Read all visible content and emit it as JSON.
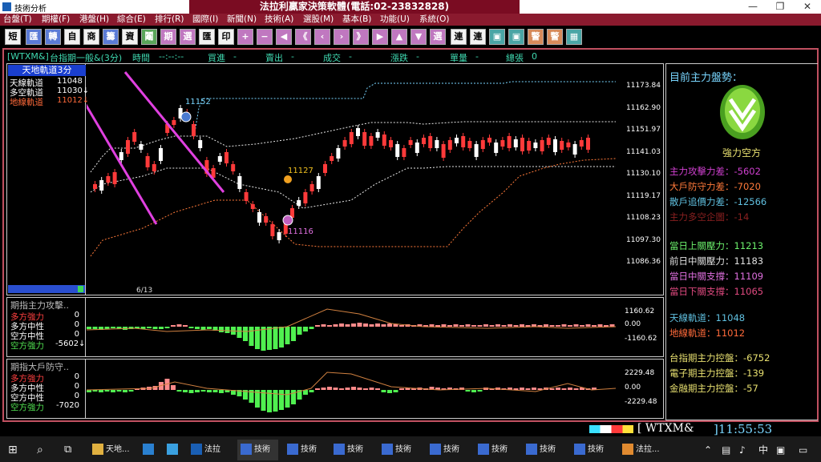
{
  "window": {
    "app_title": "技術分析",
    "banner": "法拉利贏家決策軟體(電話:02-23832828)",
    "min": "—",
    "max": "❐",
    "close": "✕"
  },
  "menu": [
    "台盤(T)",
    "期權(F)",
    "港盤(H)",
    "綜合(E)",
    "排行(R)",
    "國際(I)",
    "新聞(N)",
    "技術(A)",
    "選股(M)",
    "基本(B)",
    "功能(U)",
    "系統(O)"
  ],
  "toolbar": [
    "短",
    "匯",
    "轉",
    "自",
    "商",
    "籌",
    "資",
    "鬮",
    "期",
    "選",
    "匯",
    "印",
    "+",
    "−",
    "◀",
    "《",
    "‹",
    "›",
    "》",
    "▶",
    "▲",
    "▼",
    "選",
    "連",
    "連",
    "▣",
    "▣",
    "警",
    "警",
    "▦"
  ],
  "info": {
    "symbol": "[WTXM&]",
    "name": "台指期一般&(3分)",
    "time_label": "時間",
    "time_val": "--:--:--",
    "buy_label": "買進",
    "buy_val": "-",
    "sell_label": "賣出",
    "sell_val": "-",
    "deal_label": "成交",
    "deal_val": "-",
    "chg_label": "漲跌",
    "chg_val": "-",
    "vol_label": "單量",
    "vol_val": "-",
    "total_label": "總張",
    "total_val": "0"
  },
  "indicator": {
    "title": "天地軌道3分",
    "items": [
      {
        "label": "天線軌道",
        "value": "11048",
        "color": "#ffffff"
      },
      {
        "label": "多空軌道",
        "value": "11030↓",
        "color": "#ffffff"
      },
      {
        "label": "地線軌道",
        "value": "11012↓",
        "color": "#ff6a3a"
      }
    ]
  },
  "price_scale": [
    "11173.84",
    "11162.90",
    "11151.97",
    "11141.03",
    "11130.10",
    "11119.17",
    "11108.23",
    "11097.30",
    "11086.36"
  ],
  "annotations": {
    "high": "11152",
    "mid": "11127",
    "low": "11116",
    "date": "6/13"
  },
  "side": {
    "title": "目前主力盤勢：",
    "status": "強力空方",
    "items": [
      {
        "label": "主力攻擊力差：",
        "value": "-5602",
        "color": "#d040d0"
      },
      {
        "label": "大戶防守力差：",
        "value": "-7020",
        "color": "#ff7a3a"
      },
      {
        "label": "散戶追價力差：",
        "value": "-12566",
        "color": "#60c0e0"
      },
      {
        "label": "主力多空企圖：",
        "value": "-14",
        "color": "#8a2020"
      },
      {
        "label": "當日上關壓力：",
        "value": "11213",
        "color": "#6cf06c"
      },
      {
        "label": "前日中關壓力：",
        "value": "11183",
        "color": "#e0e0e0"
      },
      {
        "label": "當日中關支撐：",
        "value": "11109",
        "color": "#e070e0"
      },
      {
        "label": "當日下關支撐：",
        "value": "11065",
        "color": "#e04a80"
      },
      {
        "label": "天線軌道：",
        "value": "11048",
        "color": "#60c0e0"
      },
      {
        "label": "地線軌道：",
        "value": "11012",
        "color": "#ff6a3a"
      },
      {
        "label": "台指期主力控盤：",
        "value": "-6752",
        "color": "#e8e070"
      },
      {
        "label": "電子期主力控盤：",
        "value": "-139",
        "color": "#e8e070"
      },
      {
        "label": "金融期主力控盤：",
        "value": "-57",
        "color": "#e8e070"
      }
    ]
  },
  "sub1": {
    "title": "期指主力攻擊..",
    "scale": [
      "1160.62",
      "0.00",
      "-1160.62"
    ],
    "items": [
      {
        "label": "多方強力",
        "value": "0",
        "color": "#ff4040"
      },
      {
        "label": "多方中性",
        "value": "0",
        "color": "#ffffff"
      },
      {
        "label": "空方中性",
        "value": "0",
        "color": "#ffffff"
      },
      {
        "label": "空方強力",
        "value": "-5602↓",
        "color": "#50e050"
      }
    ]
  },
  "sub2": {
    "title": "期指大戶防守..",
    "scale": [
      "2229.48",
      "0.00",
      "-2229.48"
    ],
    "items": [
      {
        "label": "多方強力",
        "value": "0",
        "color": "#ff4040"
      },
      {
        "label": "多方中性",
        "value": "0",
        "color": "#ffffff"
      },
      {
        "label": "空方中性",
        "value": "0",
        "color": "#ffffff"
      },
      {
        "label": "空方強力",
        "value": "-7020",
        "color": "#50e050"
      }
    ]
  },
  "status": {
    "symbol": "[ WTXM&",
    "time": "]11:55:53"
  },
  "taskbar": {
    "items": [
      "天地...",
      "法拉",
      "技術",
      "技術",
      "技術",
      "技術",
      "技術",
      "技術",
      "技術",
      "技術",
      "法拉..."
    ],
    "tray": "中"
  }
}
